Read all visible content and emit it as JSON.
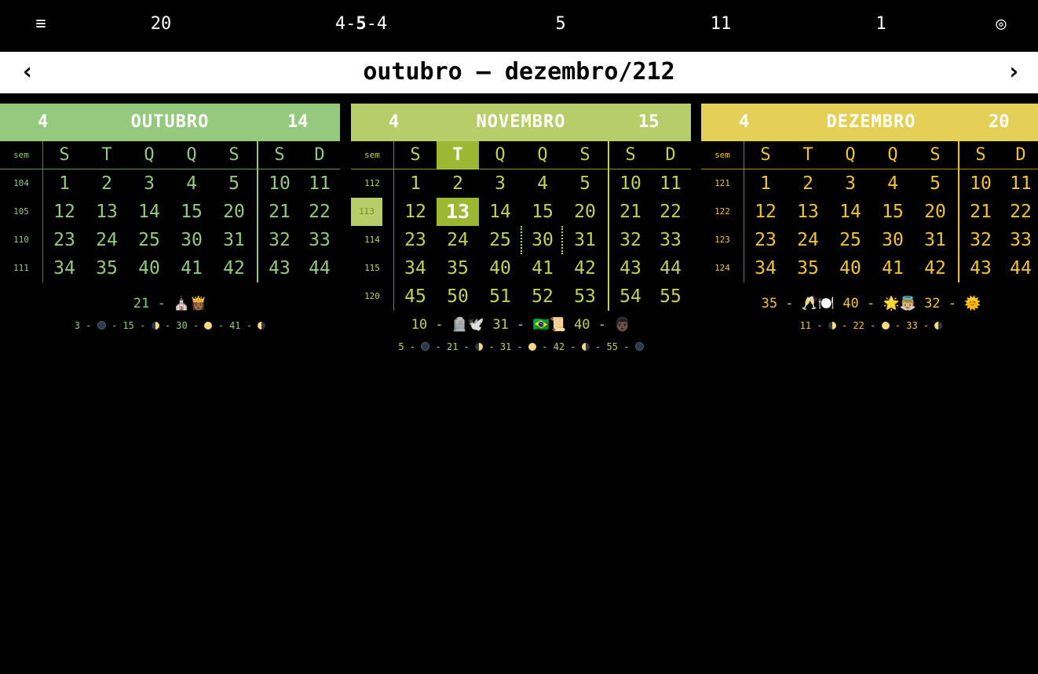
{
  "topbar": {
    "menu_icon": "≡",
    "items": [
      "20",
      "5",
      "11",
      "1"
    ],
    "pattern_pre": "4-",
    "pattern_mid": "5",
    "pattern_post": "-4",
    "target_icon": "◎"
  },
  "titlebar": {
    "title": "outubro — dezembro/212",
    "prev": "‹",
    "next": "›"
  },
  "week_header_label": "sem",
  "weekdays": [
    "S",
    "T",
    "Q",
    "Q",
    "S",
    "S",
    "D"
  ],
  "months": [
    {
      "name": "OUTUBRO",
      "left_num": "4",
      "right_num": "14",
      "header_color": "#95c97d",
      "text_color": "#95c97d",
      "weeks": [
        "104",
        "105",
        "110",
        "111"
      ],
      "days": [
        [
          "1",
          "2",
          "3",
          "4",
          "5",
          "10",
          "11"
        ],
        [
          "12",
          "13",
          "14",
          "15",
          "20",
          "21",
          "22"
        ],
        [
          "23",
          "24",
          "25",
          "30",
          "31",
          "32",
          "33"
        ],
        [
          "34",
          "35",
          "40",
          "41",
          "42",
          "43",
          "44"
        ]
      ],
      "notes": {
        "line1": "21 - ⛪👸🏾",
        "moons": [
          {
            "day": "3",
            "phase": "new"
          },
          {
            "day": "15",
            "phase": "first-quarter"
          },
          {
            "day": "30",
            "phase": "full"
          },
          {
            "day": "41",
            "phase": "last-quarter"
          }
        ]
      }
    },
    {
      "name": "NOVEMBRO",
      "left_num": "4",
      "right_num": "15",
      "header_color": "#b6cd6a",
      "text_color": "#c4cf55",
      "weeks": [
        "112",
        "113",
        "114",
        "115",
        "120"
      ],
      "current_week": "113",
      "today": "13",
      "days": [
        [
          "1",
          "2",
          "3",
          "4",
          "5",
          "10",
          "11"
        ],
        [
          "12",
          "13",
          "14",
          "15",
          "20",
          "21",
          "22"
        ],
        [
          "23",
          "24",
          "25",
          "30",
          "31",
          "32",
          "33"
        ],
        [
          "34",
          "35",
          "40",
          "41",
          "42",
          "43",
          "44"
        ],
        [
          "45",
          "50",
          "51",
          "52",
          "53",
          "54",
          "55"
        ]
      ],
      "notes": {
        "line1": "10 - 🪦🕊️ 31 - 🇧🇷📜 40 - 👨🏿",
        "moons": [
          {
            "day": "5",
            "phase": "new"
          },
          {
            "day": "21",
            "phase": "first-quarter"
          },
          {
            "day": "31",
            "phase": "full"
          },
          {
            "day": "42",
            "phase": "last-quarter"
          },
          {
            "day": "55",
            "phase": "new"
          }
        ]
      }
    },
    {
      "name": "DEZEMBRO",
      "left_num": "4",
      "right_num": "20",
      "header_color": "#e4d057",
      "text_color": "#f0c33a",
      "weeks": [
        "121",
        "122",
        "123",
        "124"
      ],
      "days": [
        [
          "1",
          "2",
          "3",
          "4",
          "5",
          "10",
          "11"
        ],
        [
          "12",
          "13",
          "14",
          "15",
          "20",
          "21",
          "22"
        ],
        [
          "23",
          "24",
          "25",
          "30",
          "31",
          "32",
          "33"
        ],
        [
          "34",
          "35",
          "40",
          "41",
          "42",
          "43",
          "44"
        ]
      ],
      "notes": {
        "line1": "35 - 🥂🍽️ 40 - 🌟👼🏼 32 - 🌞",
        "moons": [
          {
            "day": "11",
            "phase": "first-quarter"
          },
          {
            "day": "22",
            "phase": "full"
          },
          {
            "day": "33",
            "phase": "last-quarter"
          }
        ]
      }
    }
  ],
  "colors": {
    "today_bg": "#9cb832",
    "current_week_bg": "#b6cd6a",
    "current_week_text": "#7a8a2a"
  }
}
